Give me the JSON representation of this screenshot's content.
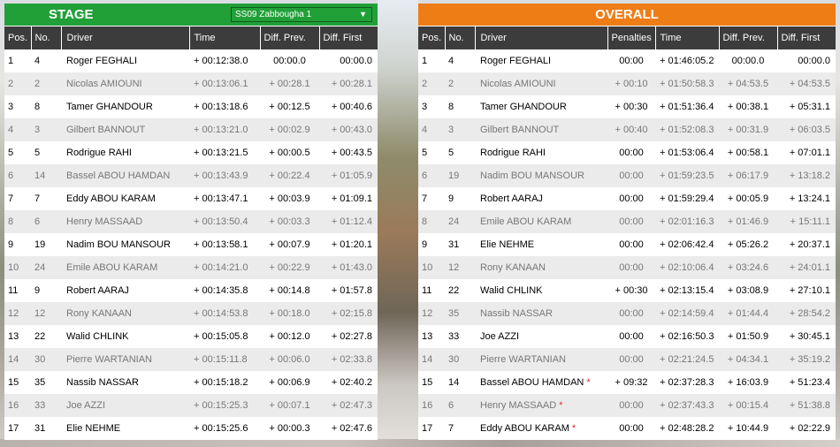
{
  "stage": {
    "title": "STAGE",
    "selected_stage": "SS09 Zabbougha 1",
    "dropdown_arrow": "▼",
    "columns": [
      "Pos.",
      "No.",
      "Driver",
      "Time",
      "Diff. Prev.",
      "Diff. First"
    ],
    "rows": [
      {
        "pos": "1",
        "no": "4",
        "driver": "Roger FEGHALI",
        "time": "+ 00:12:38.0",
        "diff_prev": "00:00.0",
        "diff_first": "00:00.0"
      },
      {
        "pos": "2",
        "no": "2",
        "driver": "Nicolas AMIOUNI",
        "time": "+ 00:13:06.1",
        "diff_prev": "+ 00:28.1",
        "diff_first": "+ 00:28.1"
      },
      {
        "pos": "3",
        "no": "8",
        "driver": "Tamer GHANDOUR",
        "time": "+ 00:13:18.6",
        "diff_prev": "+ 00:12.5",
        "diff_first": "+ 00:40.6"
      },
      {
        "pos": "4",
        "no": "3",
        "driver": "Gilbert BANNOUT",
        "time": "+ 00:13:21.0",
        "diff_prev": "+ 00:02.9",
        "diff_first": "+ 00:43.0"
      },
      {
        "pos": "5",
        "no": "5",
        "driver": "Rodrigue RAHI",
        "time": "+ 00:13:21.5",
        "diff_prev": "+ 00:00.5",
        "diff_first": "+ 00:43.5"
      },
      {
        "pos": "6",
        "no": "14",
        "driver": "Bassel ABOU HAMDAN",
        "time": "+ 00:13:43.9",
        "diff_prev": "+ 00:22.4",
        "diff_first": "+ 01:05.9"
      },
      {
        "pos": "7",
        "no": "7",
        "driver": "Eddy ABOU KARAM",
        "time": "+ 00:13:47.1",
        "diff_prev": "+ 00:03.9",
        "diff_first": "+ 01:09.1"
      },
      {
        "pos": "8",
        "no": "6",
        "driver": "Henry MASSAAD",
        "time": "+ 00:13:50.4",
        "diff_prev": "+ 00:03.3",
        "diff_first": "+ 01:12.4"
      },
      {
        "pos": "9",
        "no": "19",
        "driver": "Nadim BOU MANSOUR",
        "time": "+ 00:13:58.1",
        "diff_prev": "+ 00:07.9",
        "diff_first": "+ 01:20.1"
      },
      {
        "pos": "10",
        "no": "24",
        "driver": "Emile ABOU KARAM",
        "time": "+ 00:14:21.0",
        "diff_prev": "+ 00:22.9",
        "diff_first": "+ 01:43.0"
      },
      {
        "pos": "11",
        "no": "9",
        "driver": "Robert AARAJ",
        "time": "+ 00:14:35.8",
        "diff_prev": "+ 00:14.8",
        "diff_first": "+ 01:57.8"
      },
      {
        "pos": "12",
        "no": "12",
        "driver": "Rony KANAAN",
        "time": "+ 00:14:53.8",
        "diff_prev": "+ 00:18.0",
        "diff_first": "+ 02:15.8"
      },
      {
        "pos": "13",
        "no": "22",
        "driver": "Walid CHLINK",
        "time": "+ 00:15:05.8",
        "diff_prev": "+ 00:12.0",
        "diff_first": "+ 02:27.8"
      },
      {
        "pos": "14",
        "no": "30",
        "driver": "Pierre WARTANIAN",
        "time": "+ 00:15:11.8",
        "diff_prev": "+ 00:06.0",
        "diff_first": "+ 02:33.8"
      },
      {
        "pos": "15",
        "no": "35",
        "driver": "Nassib NASSAR",
        "time": "+ 00:15:18.2",
        "diff_prev": "+ 00:06.9",
        "diff_first": "+ 02:40.2"
      },
      {
        "pos": "16",
        "no": "33",
        "driver": "Joe AZZI",
        "time": "+ 00:15:25.3",
        "diff_prev": "+ 00:07.1",
        "diff_first": "+ 02:47.3"
      },
      {
        "pos": "17",
        "no": "31",
        "driver": "Elie NEHME",
        "time": "+ 00:15:25.6",
        "diff_prev": "+ 00:00.3",
        "diff_first": "+ 02:47.6"
      }
    ]
  },
  "overall": {
    "title": "OVERALL",
    "columns": [
      "Pos.",
      "No.",
      "Driver",
      "Penalties",
      "Time",
      "Diff. Prev.",
      "Diff. First"
    ],
    "star_color": "#e1252b",
    "rows": [
      {
        "pos": "1",
        "no": "4",
        "driver": "Roger FEGHALI",
        "star": "",
        "penalty": "00:00",
        "time": "+ 01:46:05.2",
        "diff_prev": "00:00.0",
        "diff_first": "00:00.0"
      },
      {
        "pos": "2",
        "no": "2",
        "driver": "Nicolas AMIOUNI",
        "star": "",
        "penalty": "+ 00:10",
        "time": "+ 01:50:58.3",
        "diff_prev": "+ 04:53.5",
        "diff_first": "+ 04:53.5"
      },
      {
        "pos": "3",
        "no": "8",
        "driver": "Tamer GHANDOUR",
        "star": "",
        "penalty": "+ 00:30",
        "time": "+ 01:51:36.4",
        "diff_prev": "+ 00:38.1",
        "diff_first": "+ 05:31.1"
      },
      {
        "pos": "4",
        "no": "3",
        "driver": "Gilbert BANNOUT",
        "star": "",
        "penalty": "+ 00:40",
        "time": "+ 01:52:08.3",
        "diff_prev": "+ 00:31.9",
        "diff_first": "+ 06:03.5"
      },
      {
        "pos": "5",
        "no": "5",
        "driver": "Rodrigue RAHI",
        "star": "",
        "penalty": "00:00",
        "time": "+ 01:53:06.4",
        "diff_prev": "+ 00:58.1",
        "diff_first": "+ 07:01.1"
      },
      {
        "pos": "6",
        "no": "19",
        "driver": "Nadim BOU MANSOUR",
        "star": "",
        "penalty": "00:00",
        "time": "+ 01:59:23.5",
        "diff_prev": "+ 06:17.9",
        "diff_first": "+ 13:18.2"
      },
      {
        "pos": "7",
        "no": "9",
        "driver": "Robert AARAJ",
        "star": "",
        "penalty": "00:00",
        "time": "+ 01:59:29.4",
        "diff_prev": "+ 00:05.9",
        "diff_first": "+ 13:24.1"
      },
      {
        "pos": "8",
        "no": "24",
        "driver": "Emile ABOU KARAM",
        "star": "",
        "penalty": "00:00",
        "time": "+ 02:01:16.3",
        "diff_prev": "+ 01:46.9",
        "diff_first": "+ 15:11.1"
      },
      {
        "pos": "9",
        "no": "31",
        "driver": "Elie NEHME",
        "star": "",
        "penalty": "00:00",
        "time": "+ 02:06:42.4",
        "diff_prev": "+ 05:26.2",
        "diff_first": "+ 20:37.1"
      },
      {
        "pos": "10",
        "no": "12",
        "driver": "Rony KANAAN",
        "star": "",
        "penalty": "00:00",
        "time": "+ 02:10:06.4",
        "diff_prev": "+ 03:24.6",
        "diff_first": "+ 24:01.1"
      },
      {
        "pos": "11",
        "no": "22",
        "driver": "Walid CHLINK",
        "star": "",
        "penalty": "+ 00:30",
        "time": "+ 02:13:15.4",
        "diff_prev": "+ 03:08.9",
        "diff_first": "+ 27:10.1"
      },
      {
        "pos": "12",
        "no": "35",
        "driver": "Nassib NASSAR",
        "star": "",
        "penalty": "00:00",
        "time": "+ 02:14:59.4",
        "diff_prev": "+ 01:44.4",
        "diff_first": "+ 28:54.2"
      },
      {
        "pos": "13",
        "no": "33",
        "driver": "Joe AZZI",
        "star": "",
        "penalty": "00:00",
        "time": "+ 02:16:50.3",
        "diff_prev": "+ 01:50.9",
        "diff_first": "+ 30:45.1"
      },
      {
        "pos": "14",
        "no": "30",
        "driver": "Pierre WARTANIAN",
        "star": "",
        "penalty": "00:00",
        "time": "+ 02:21:24.5",
        "diff_prev": "+ 04:34.1",
        "diff_first": "+ 35:19.2"
      },
      {
        "pos": "15",
        "no": "14",
        "driver": "Bassel ABOU HAMDAN",
        "star": "*",
        "penalty": "+ 09:32",
        "time": "+ 02:37:28.3",
        "diff_prev": "+ 16:03.9",
        "diff_first": "+ 51:23.4"
      },
      {
        "pos": "16",
        "no": "6",
        "driver": "Henry MASSAAD",
        "star": "*",
        "penalty": "00:00",
        "time": "+ 02:37:43.3",
        "diff_prev": "+ 00:15.4",
        "diff_first": "+ 51:38.8"
      },
      {
        "pos": "17",
        "no": "7",
        "driver": "Eddy ABOU KARAM",
        "star": "*",
        "penalty": "00:00",
        "time": "+ 02:48:28.2",
        "diff_prev": "+ 10:44.9",
        "diff_first": "+ 02:22.9"
      }
    ]
  }
}
